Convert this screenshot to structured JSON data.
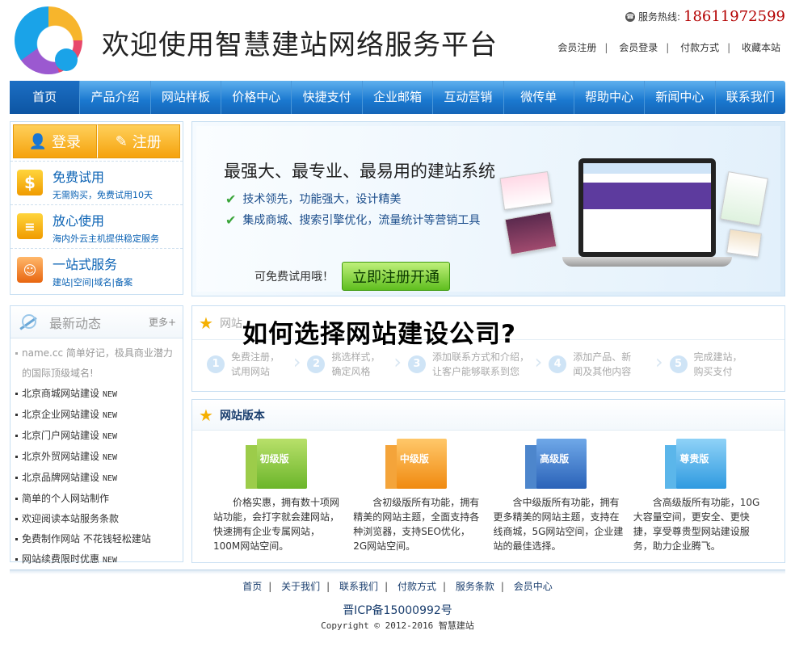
{
  "header": {
    "site_title": "欢迎使用智慧建站网络服务平台",
    "hotline_label": "服务热线:",
    "hotline_number": "18611972599",
    "top_links": [
      "会员注册",
      "会员登录",
      "付款方式",
      "收藏本站"
    ]
  },
  "nav": [
    "首页",
    "产品介绍",
    "网站样板",
    "价格中心",
    "快捷支付",
    "企业邮箱",
    "互动营销",
    "微传单",
    "帮助中心",
    "新闻中心",
    "联系我们"
  ],
  "auth": {
    "login": "登录",
    "register": "注册"
  },
  "features": [
    {
      "title": "免费试用",
      "desc": "无需购买，免费试用10天"
    },
    {
      "title": "放心使用",
      "desc": "海内外云主机提供稳定服务"
    },
    {
      "title": "一站式服务",
      "desc": "建站|空间|域名|备案"
    }
  ],
  "news": {
    "title": "最新动态",
    "more": "更多+",
    "first": "name.cc 简单好记，极具商业潜力的国际顶级域名!",
    "new_tag": "NEW",
    "items": [
      {
        "text": "北京商城网站建设",
        "new": true
      },
      {
        "text": "北京企业网站建设",
        "new": true
      },
      {
        "text": "北京门户网站建设",
        "new": true
      },
      {
        "text": "北京外贸网站建设",
        "new": true
      },
      {
        "text": "北京品牌网站建设",
        "new": true
      },
      {
        "text": "简单的个人网站制作",
        "new": false
      },
      {
        "text": "欢迎阅读本站服务条款",
        "new": false
      },
      {
        "text": "免费制作网站 不花钱轻松建站",
        "new": false
      },
      {
        "text": "网站续费限时优惠",
        "new": true
      }
    ]
  },
  "banner": {
    "headline": "最强大、最专业、最易用的建站系统",
    "points": [
      "技术领先，功能强大，设计精美",
      "集成商城、搜索引擎优化，流量统计等营销工具"
    ],
    "cta_text": "可免费试用哦！",
    "cta_button": "立即注册开通"
  },
  "process": {
    "title": "网站",
    "overlay_title": "如何选择网站建设公司?",
    "steps": [
      {
        "n": "1",
        "line1": "免费注册，",
        "line2": "试用网站"
      },
      {
        "n": "2",
        "line1": "挑选样式，",
        "line2": "确定风格"
      },
      {
        "n": "3",
        "line1": "添加联系方式和介绍，",
        "line2": "让客户能够联系到您"
      },
      {
        "n": "4",
        "line1": "添加产品、新",
        "line2": "闻及其他内容"
      },
      {
        "n": "5",
        "line1": "完成建站，",
        "line2": "购买支付"
      }
    ]
  },
  "versions": {
    "title": "网站版本",
    "items": [
      {
        "label": "初级版",
        "color": "green",
        "desc": "价格实惠，拥有数十项网站功能，会打字就会建网站，快速拥有企业专属网站，100M网站空间。"
      },
      {
        "label": "中级版",
        "color": "orange",
        "desc": "含初级版所有功能，拥有精美的网站主题，全面支持各种浏览器，支持SEO优化，2G网站空间。"
      },
      {
        "label": "高级版",
        "color": "blue",
        "desc": "含中级版所有功能，拥有更多精美的网站主题，支持在线商城，5G网站空间，企业建站的最佳选择。"
      },
      {
        "label": "尊贵版",
        "color": "sky",
        "desc": "含高级版所有功能，10G大容量空间，更安全、更快捷，享受尊贵型网站建设服务，助力企业腾飞。"
      }
    ]
  },
  "footer": {
    "links": [
      "首页",
      "关于我们",
      "联系我们",
      "付款方式",
      "服务条款",
      "会员中心"
    ],
    "icp": "晋ICP备15000992号",
    "copyright": "Copyright © 2012-2016 智慧建站"
  }
}
